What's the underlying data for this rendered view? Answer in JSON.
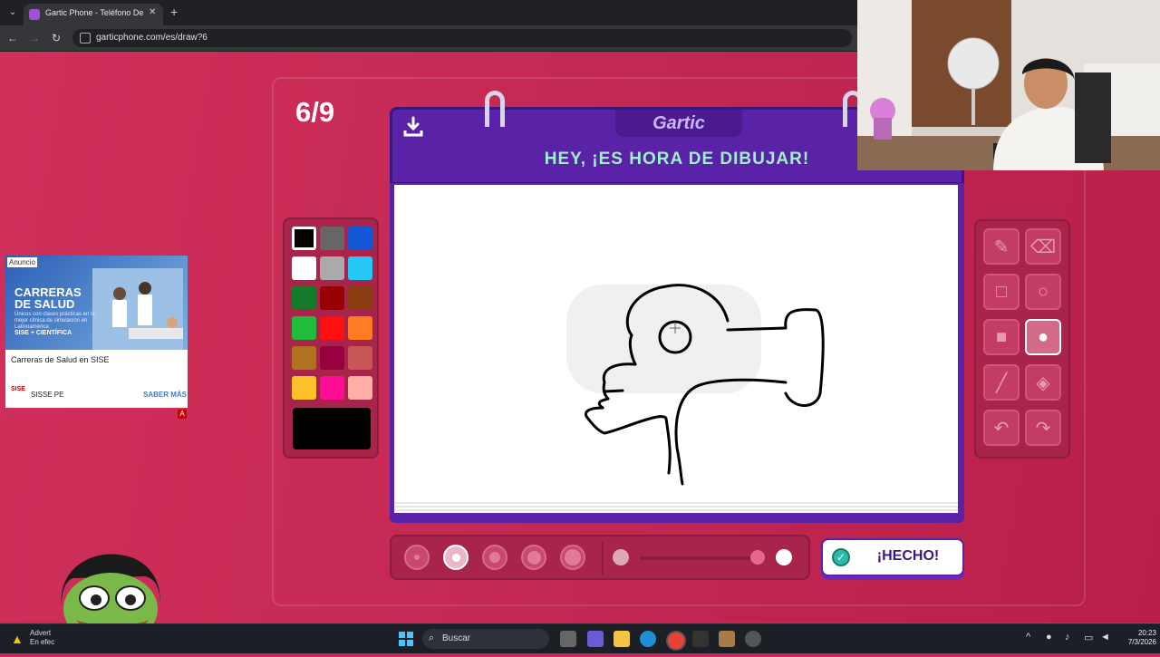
{
  "browser": {
    "tab_title": "Gartic Phone - Teléfono Descon",
    "url": "garticphone.com/es/draw?6"
  },
  "game": {
    "counter": "6/9",
    "logo": "Gartic",
    "header_title": "HEY, ¡ES HORA DE DIBUJAR!",
    "done_label": "¡HECHO!",
    "palette": [
      {
        "color": "#000000",
        "selected": true
      },
      {
        "color": "#666666"
      },
      {
        "color": "#1356d6"
      },
      {
        "color": "#ffffff"
      },
      {
        "color": "#aaaaaa"
      },
      {
        "color": "#25c8f5"
      },
      {
        "color": "#157a2c"
      },
      {
        "color": "#990000"
      },
      {
        "color": "#8a3e12"
      },
      {
        "color": "#1fbd3a"
      },
      {
        "color": "#ff0f0f"
      },
      {
        "color": "#ff7c25"
      },
      {
        "color": "#b07120"
      },
      {
        "color": "#990040"
      },
      {
        "color": "#c95656"
      },
      {
        "color": "#ffc129"
      },
      {
        "color": "#ff0c97"
      },
      {
        "color": "#ffafa5"
      }
    ],
    "current_color": "#000000",
    "tools": [
      {
        "name": "pencil-tool",
        "icon": "pencil-icon"
      },
      {
        "name": "eraser-tool",
        "icon": "eraser-icon"
      },
      {
        "name": "rectangle-outline-tool",
        "icon": "square-outline-icon"
      },
      {
        "name": "ellipse-outline-tool",
        "icon": "circle-outline-icon"
      },
      {
        "name": "rectangle-fill-tool",
        "icon": "square-filled-icon"
      },
      {
        "name": "ellipse-fill-tool",
        "icon": "circle-filled-icon",
        "active": true
      },
      {
        "name": "line-tool",
        "icon": "line-icon"
      },
      {
        "name": "fill-bucket-tool",
        "icon": "paint-bucket-icon"
      },
      {
        "name": "undo-tool",
        "icon": "undo-icon"
      },
      {
        "name": "redo-tool",
        "icon": "redo-icon"
      }
    ],
    "brush_sizes": [
      1,
      2,
      3,
      4,
      5
    ],
    "selected_brush_size": 2,
    "opacity": 1.0
  },
  "ad": {
    "badge": "Anuncio",
    "headline": "CARRERAS DE SALUD",
    "subtext": "Únicos con clases prácticas en la mejor clínica de simulación en Latinoamérica",
    "image_brand": "SISE + CIENTÍFICA",
    "title": "Carreras de Salud en SISE",
    "logo": "SISE",
    "brand": "SISSE PE",
    "cta": "SABER MÁS",
    "corner": "A"
  },
  "taskbar": {
    "warning_line1": "Advert",
    "warning_line2": "En efec",
    "search_placeholder": "Buscar",
    "time": "20:23",
    "date": "7/3/2026"
  }
}
